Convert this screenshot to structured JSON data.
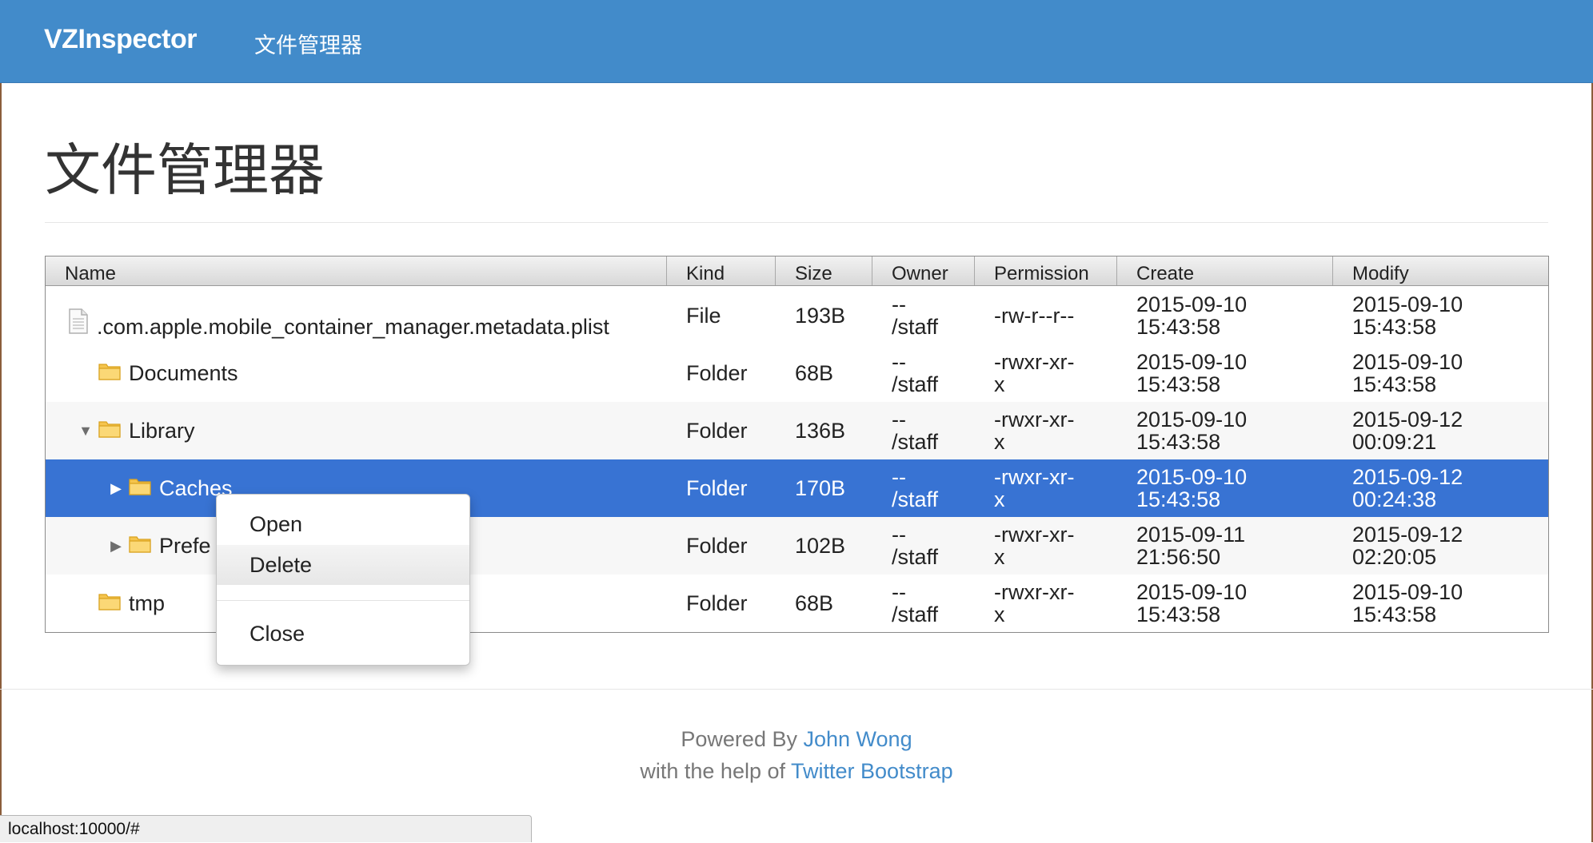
{
  "navbar": {
    "brand": "VZInspector",
    "link": "文件管理器"
  },
  "page": {
    "heading": "文件管理器"
  },
  "table": {
    "columns": [
      "Name",
      "Kind",
      "Size",
      "Owner",
      "Permission",
      "Create",
      "Modify"
    ],
    "rows": [
      {
        "name": ".com.apple.mobile_container_manager.metadata.plist",
        "icon": "document-icon",
        "kind": "File",
        "size": "193B",
        "owner_1": "--",
        "owner_2": "/staff",
        "perm_1": "-rw-r--r--",
        "perm_2": "",
        "create_1": "2015-09-10",
        "create_2": "15:43:58",
        "modify_1": "2015-09-10",
        "modify_2": "15:43:58"
      },
      {
        "name": "Documents",
        "icon": "folder-icon",
        "kind": "Folder",
        "size": "68B",
        "owner_1": "--",
        "owner_2": "/staff",
        "perm_1": "-rwxr-xr-",
        "perm_2": "x",
        "create_1": "2015-09-10",
        "create_2": "15:43:58",
        "modify_1": "2015-09-10",
        "modify_2": "15:43:58"
      },
      {
        "name": "Library",
        "icon": "folder-icon",
        "expander": "▼",
        "kind": "Folder",
        "size": "136B",
        "owner_1": "--",
        "owner_2": "/staff",
        "perm_1": "-rwxr-xr-",
        "perm_2": "x",
        "create_1": "2015-09-10",
        "create_2": "15:43:58",
        "modify_1": "2015-09-12",
        "modify_2": "00:09:21"
      },
      {
        "name": "Caches",
        "icon": "folder-icon",
        "expander": "▶",
        "selected": true,
        "kind": "Folder",
        "size": "170B",
        "owner_1": "--",
        "owner_2": "/staff",
        "perm_1": "-rwxr-xr-",
        "perm_2": "x",
        "create_1": "2015-09-10",
        "create_2": "15:43:58",
        "modify_1": "2015-09-12",
        "modify_2": "00:24:38"
      },
      {
        "name": "Prefe",
        "icon": "folder-icon",
        "expander": "▶",
        "kind": "Folder",
        "size": "102B",
        "owner_1": "--",
        "owner_2": "/staff",
        "perm_1": "-rwxr-xr-",
        "perm_2": "x",
        "create_1": "2015-09-11",
        "create_2": "21:56:50",
        "modify_1": "2015-09-12",
        "modify_2": "02:20:05"
      },
      {
        "name": "tmp",
        "icon": "folder-icon",
        "kind": "Folder",
        "size": "68B",
        "owner_1": "--",
        "owner_2": "/staff",
        "perm_1": "-rwxr-xr-",
        "perm_2": "x",
        "create_1": "2015-09-10",
        "create_2": "15:43:58",
        "modify_1": "2015-09-10",
        "modify_2": "15:43:58"
      }
    ]
  },
  "context_menu": {
    "open": "Open",
    "delete": "Delete",
    "close": "Close"
  },
  "footer": {
    "powered_by": "Powered By",
    "author": "John Wong",
    "help_prefix": "with the help of",
    "help_link": "Twitter Bootstrap"
  },
  "statusbar": {
    "url": "localhost:10000/#"
  },
  "colors": {
    "navbar": "#428bca",
    "selection": "#3873d3",
    "link": "#428bca"
  }
}
